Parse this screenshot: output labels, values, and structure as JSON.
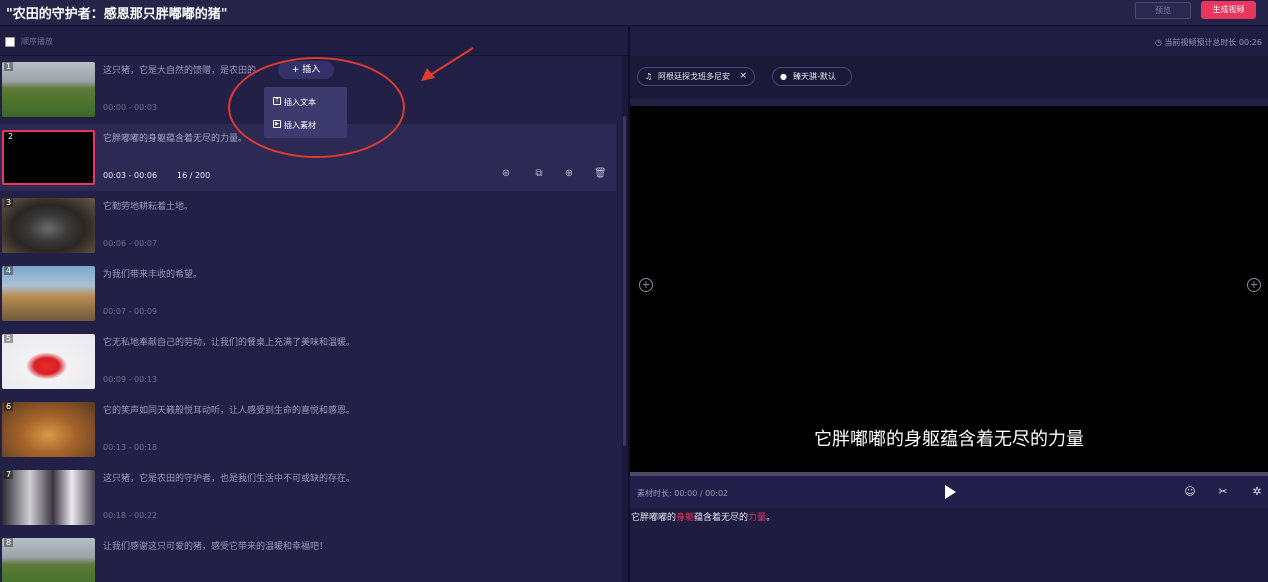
{
  "header": {
    "title": "\"农田的守护者：感恩那只胖嘟嘟的猪\"",
    "preview_label": "预览",
    "generate_label": "生成视频"
  },
  "left": {
    "sequential_play_label": "顺序播放",
    "insert_button_label": "+ 插入",
    "insert_menu": {
      "insert_text_label": "插入文本",
      "insert_media_label": "插入素材"
    },
    "clips": [
      {
        "num": "1",
        "text": "这只猪，它是大自然的馈赠，是农田的",
        "time": "00:00 - 00:03",
        "thumb": "field"
      },
      {
        "num": "2",
        "text": "它胖嘟嘟的身躯蕴含着无尽的力量。",
        "time": "00:03 - 00:06",
        "count": "16 / 200",
        "thumb": "black"
      },
      {
        "num": "3",
        "text": "它勤劳地耕耘着土地。",
        "time": "00:06 - 00:07",
        "thumb": "pot"
      },
      {
        "num": "4",
        "text": "为我们带来丰收的希望。",
        "time": "00:07 - 00:09",
        "thumb": "street"
      },
      {
        "num": "5",
        "text": "它无私地奉献自己的劳动，让我们的餐桌上充满了美味和温暖。",
        "time": "00:09 - 00:13",
        "thumb": "jelly"
      },
      {
        "num": "6",
        "text": "它的笑声如同天籁般悦耳动听，让人感受到生命的喜悦和感恩。",
        "time": "00:13 - 00:18",
        "thumb": "basket"
      },
      {
        "num": "7",
        "text": "这只猪，它是农田的守护者，也是我们生活中不可或缺的存在。",
        "time": "00:18 - 00:22",
        "thumb": "people"
      },
      {
        "num": "8",
        "text": "让我们感谢这只可爱的猪，感受它带来的温暖和幸福吧！",
        "time": "",
        "thumb": "field"
      }
    ]
  },
  "right": {
    "total_duration_label": "当前视频预计总时长 00:26",
    "music_tag": "阿根廷探戈班多尼安",
    "voice_tag": "臻天骐-默认",
    "subtitle": "它胖嘟嘟的身躯蕴含着无尽的力量",
    "material_duration": "素材时长: 00:00 / 00:02",
    "caption_parts": [
      {
        "text": "它胖嘟嘟的",
        "highlight": false
      },
      {
        "text": "身躯",
        "highlight": true
      },
      {
        "text": "蕴含着无尽的",
        "highlight": false
      },
      {
        "text": "力量",
        "highlight": true
      },
      {
        "text": "。",
        "highlight": false
      }
    ]
  },
  "colors": {
    "accent": "#e8365d",
    "background": "#1c1a3d",
    "annotation": "#e03a2e"
  }
}
